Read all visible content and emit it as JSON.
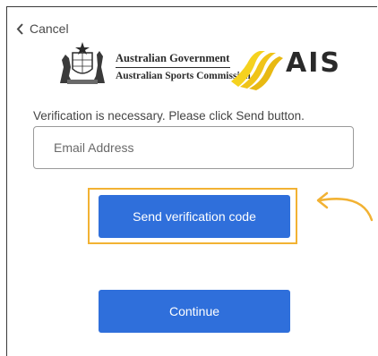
{
  "header": {
    "cancel_label": "Cancel"
  },
  "branding": {
    "gov_line1": "Australian Government",
    "gov_line2": "Australian Sports Commission",
    "ais_label": "AIS"
  },
  "form": {
    "instruction": "Verification is necessary. Please click Send button.",
    "email_placeholder": "Email Address",
    "email_value": "",
    "send_label": "Send verification code",
    "continue_label": "Continue"
  },
  "colors": {
    "button": "#2f6fdb",
    "highlight": "#f2b233",
    "ais_yellow": "#f5d21f"
  },
  "icons": {
    "cancel": "chevron-left-icon",
    "crest": "coat-of-arms-icon",
    "ais_mark": "ais-logo-mark",
    "annotation": "curved-arrow-icon"
  }
}
